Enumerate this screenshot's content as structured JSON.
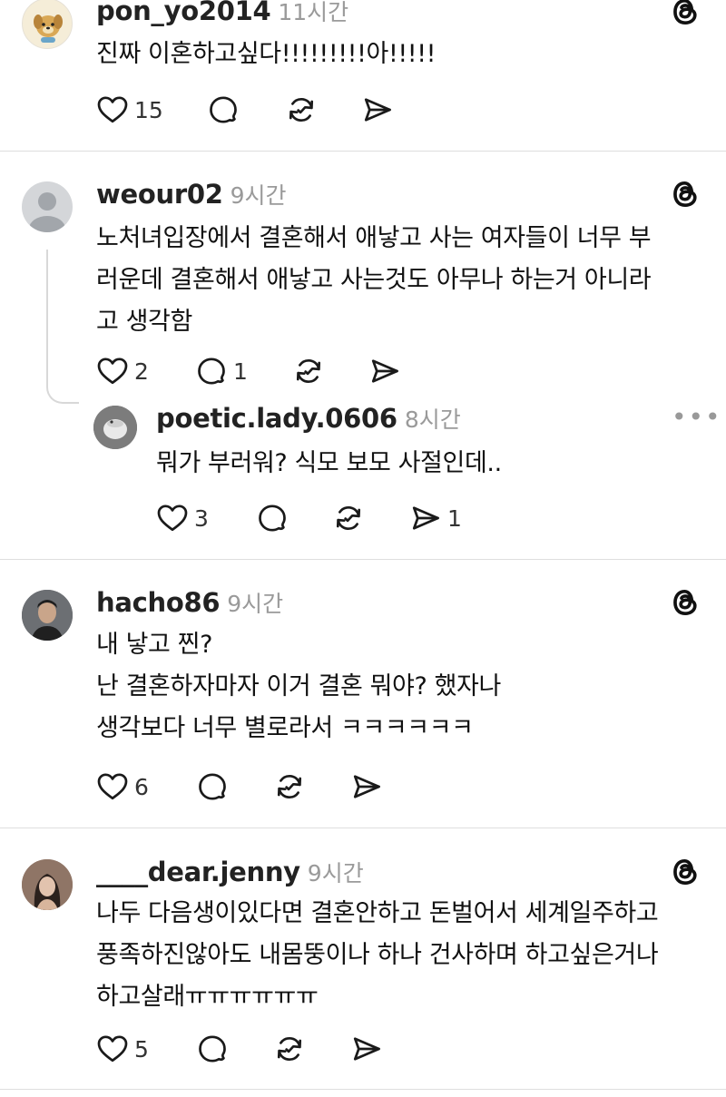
{
  "comments": [
    {
      "username": "pon_yo2014",
      "time": "11시간",
      "lines": [
        "진짜 이혼하고싶다!!!!!!!!!아!!!!!"
      ],
      "likes": "15",
      "replies": "",
      "shares": ""
    },
    {
      "username": "weour02",
      "time": "9시간",
      "lines": [
        "노처녀입장에서 결혼해서 애낳고 사는 여자들이 너무 부",
        "러운데 결혼해서 애낳고 사는것도 아무나 하는거 아니라",
        "고 생각함"
      ],
      "likes": "2",
      "replies": "1",
      "shares": ""
    },
    {
      "username": "poetic.lady.0606",
      "time": "8시간",
      "lines": [
        "뭐가 부러워? 식모 보모 사절인데.."
      ],
      "likes": "3",
      "replies": "",
      "shares": "1",
      "more": "•••"
    },
    {
      "username": "hacho86",
      "time": "9시간",
      "lines": [
        "내 낳고 찐?",
        "난 결혼하자마자 이거 결혼 뭐야? 했자나",
        "생각보다 너무 별로라서 ㅋㅋㅋㅋㅋㅋ"
      ],
      "likes": "6",
      "replies": "",
      "shares": ""
    },
    {
      "username": "____dear.jenny",
      "time": "9시간",
      "lines": [
        "나두 다음생이있다면 결혼안하고 돈벌어서 세계일주하고",
        "풍족하진않아도 내몸뚱이나 하나 건사하며 하고싶은거나",
        "하고살래ㅠㅠㅠㅠㅠㅠ"
      ],
      "likes": "5",
      "replies": "",
      "shares": ""
    }
  ],
  "icons": {
    "like": "heart-icon",
    "reply": "comment-icon",
    "repost": "repost-icon",
    "share": "send-icon",
    "logo": "threads-logo-icon",
    "avatar_placeholder": "default-avatar-icon"
  },
  "colors": {
    "text": "#111111",
    "muted": "#9a9a9a",
    "divider": "#dedede",
    "icon": "#1a1a1a"
  }
}
